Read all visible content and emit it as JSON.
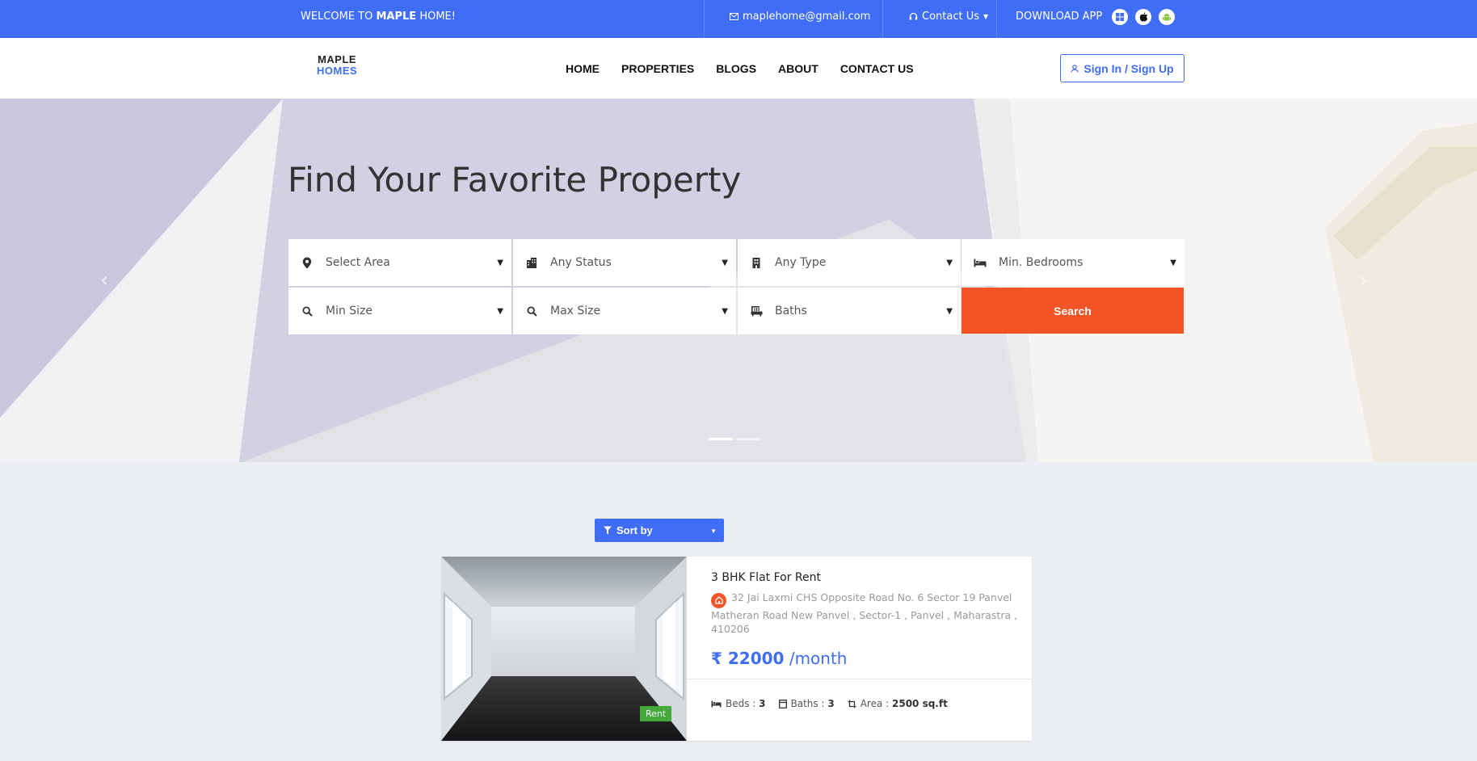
{
  "topbar": {
    "welcome_prefix": "WELCOME TO ",
    "welcome_brand": "MAPLE",
    "welcome_suffix": " HOME!",
    "email": "maplehome@gmail.com",
    "contact": "Contact Us",
    "download": "DOWNLOAD APP",
    "apps": [
      "windows-icon",
      "apple-icon",
      "android-icon"
    ]
  },
  "header": {
    "logo_line1": "MAPLE",
    "logo_line2": "HOMES",
    "nav": [
      "HOME",
      "PROPERTIES",
      "BLOGS",
      "ABOUT",
      "CONTACT US"
    ],
    "signin": "Sign In / Sign Up"
  },
  "hero": {
    "title": "Find Your Favorite Property",
    "fields": {
      "area": "Select Area",
      "status": "Any Status",
      "type": "Any Type",
      "bedrooms": "Min. Bedrooms",
      "min_size": "Min Size",
      "max_size": "Max Size",
      "baths": "Baths"
    },
    "search": "Search"
  },
  "sort": {
    "label": "Sort by"
  },
  "listing": {
    "title": "3 BHK Flat For Rent",
    "address": "32 Jai Laxmi CHS Opposite Road No. 6 Sector 19 Panvel Matheran Road New Panvel , Sector-1 , Panvel , Maharastra , 410206",
    "price": "₹ 22000",
    "period": " /month",
    "badge": "Rent",
    "beds_label": "Beds : ",
    "beds": "3",
    "baths_label": "Baths : ",
    "baths": "3",
    "area_label": "Area : ",
    "area": "2500 sq.ft"
  },
  "colors": {
    "primary": "#3f6df5",
    "accent": "#f25425",
    "badge": "#43a93a"
  }
}
